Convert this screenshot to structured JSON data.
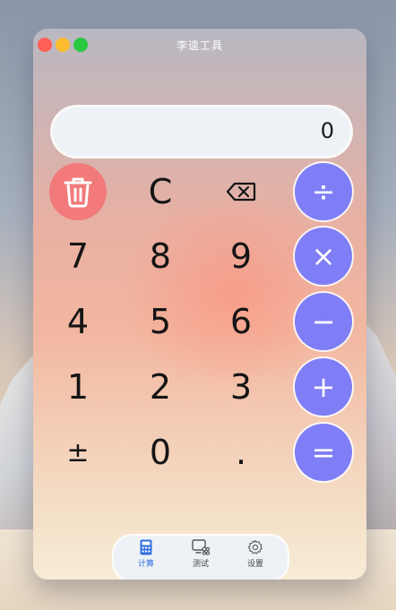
{
  "window": {
    "title": "李逵工具"
  },
  "display": {
    "value": "0"
  },
  "keys": {
    "delete": "",
    "clear": "C",
    "backspace": "",
    "divide": "÷",
    "seven": "7",
    "eight": "8",
    "nine": "9",
    "multiply": "×",
    "four": "4",
    "five": "5",
    "six": "6",
    "minus": "−",
    "one": "1",
    "two": "2",
    "three": "3",
    "plus": "+",
    "plusminus": "±",
    "zero": "0",
    "decimal": ".",
    "equals": "="
  },
  "tabs": [
    {
      "label": "计算",
      "icon": "calculator-icon",
      "active": true
    },
    {
      "label": "测试",
      "icon": "test-icon",
      "active": false
    },
    {
      "label": "设置",
      "icon": "settings-icon",
      "active": false
    }
  ],
  "colors": {
    "operator": "#7f7ef6",
    "delete": "#f27a7a",
    "active_tab": "#2f6fe0"
  }
}
